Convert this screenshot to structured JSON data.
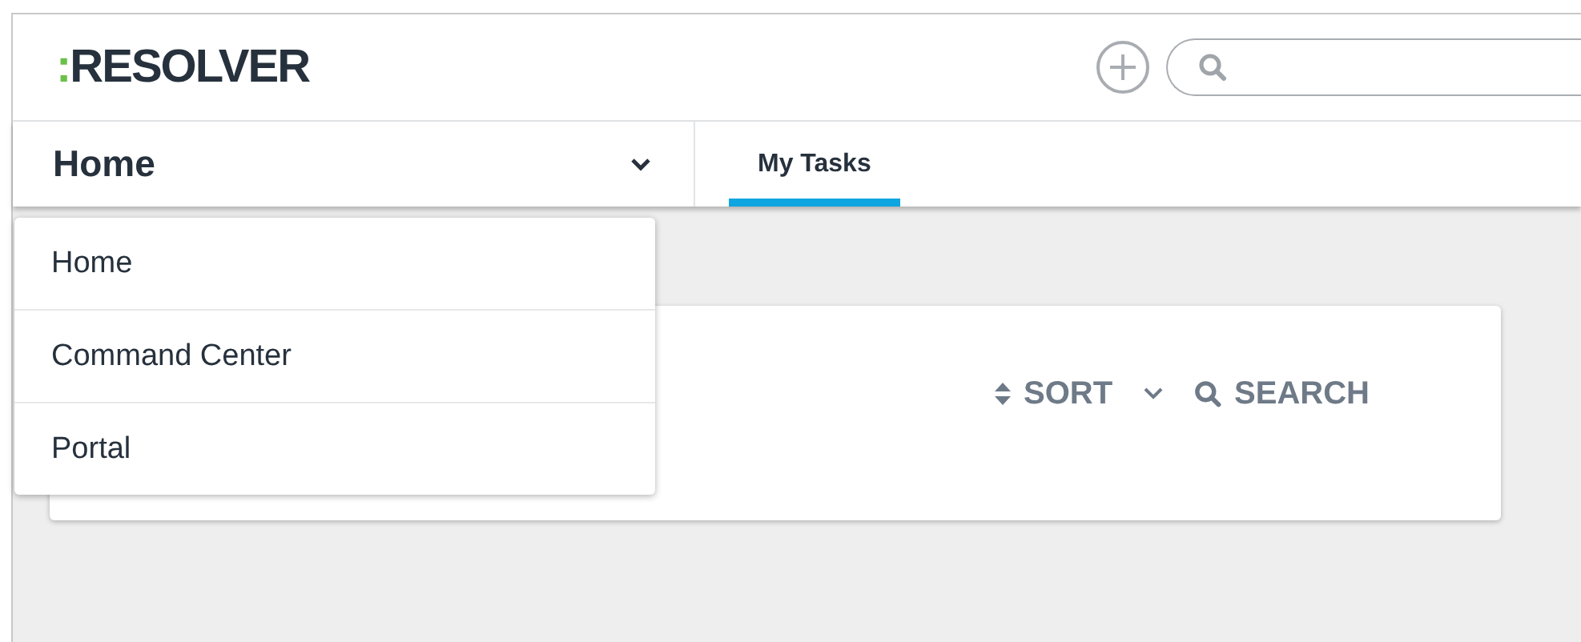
{
  "header": {
    "logo_mark": ":",
    "logo_text": "RESOLVER"
  },
  "nav": {
    "current": "Home",
    "expanded": true,
    "tabs": [
      {
        "label": "My Tasks",
        "selected": true
      }
    ]
  },
  "menu": [
    {
      "label": "Home"
    },
    {
      "label": "Command Center"
    },
    {
      "label": "Portal"
    }
  ],
  "card": {
    "sort_label": "SORT",
    "search_label": "SEARCH"
  }
}
